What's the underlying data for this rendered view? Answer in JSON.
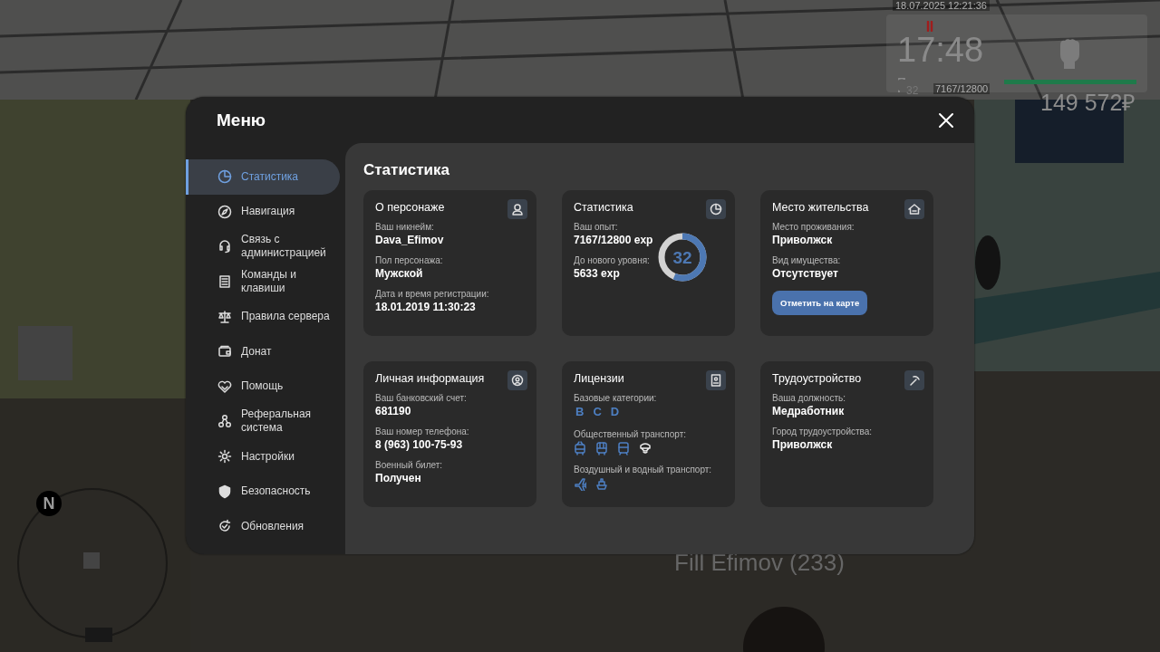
{
  "hud": {
    "datetime": "18.07.2025 12:21:36",
    "clock": "17:48",
    "level": "32",
    "experience": "7167/12800",
    "money": "149 572₽",
    "player_tag": "Fill Efimov (233)",
    "compass": "N"
  },
  "menu": {
    "title": "Меню",
    "sidebar": {
      "items": [
        {
          "label": "Статистика",
          "selected": true
        },
        {
          "label": "Навигация",
          "selected": false
        },
        {
          "label": "Связь с администрацией",
          "selected": false
        },
        {
          "label": "Команды и клавиши",
          "selected": false
        },
        {
          "label": "Правила сервера",
          "selected": false
        },
        {
          "label": "Донат",
          "selected": false
        },
        {
          "label": "Помощь",
          "selected": false
        },
        {
          "label": "Реферальная система",
          "selected": false
        },
        {
          "label": "Настройки",
          "selected": false
        },
        {
          "label": "Безопасность",
          "selected": false
        },
        {
          "label": "Обновления",
          "selected": false
        }
      ]
    },
    "content": {
      "heading": "Статистика",
      "cards": [
        {
          "kind": "character",
          "title": "О персонаже",
          "fields": [
            {
              "label": "Ваш никнейм:",
              "value": "Dava_Efimov"
            },
            {
              "label": "Пол персонажа:",
              "value": "Мужской"
            },
            {
              "label": "Дата и время регистрации:",
              "value": "18.01.2019 11:30:23"
            }
          ]
        },
        {
          "kind": "stats",
          "title": "Статистика",
          "fields": [
            {
              "label": "Ваш опыт:",
              "value": "7167/12800 exp"
            },
            {
              "label": "До нового уровня:",
              "value": "5633 exp"
            }
          ],
          "ring": {
            "value": "32",
            "level": 0.56
          }
        },
        {
          "kind": "residence",
          "title": "Место жительства",
          "fields": [
            {
              "label": "Место проживания:",
              "value": "Приволжск"
            },
            {
              "label": "Вид имущества:",
              "value": "Отсутствует"
            }
          ],
          "button": "Отметить на карте"
        },
        {
          "kind": "personal",
          "title": "Личная информация",
          "fields": [
            {
              "label": "Ваш банковский счет:",
              "value": "681190"
            },
            {
              "label": "Ваш номер телефона:",
              "value": "8 (963) 100-75-93"
            },
            {
              "label": "Военный билет:",
              "value": "Получен"
            }
          ]
        },
        {
          "kind": "licenses",
          "title": "Лицензии",
          "sections": [
            {
              "kind": "letters",
              "label": "Базовые категории:",
              "letters": [
                "B",
                "C",
                "D"
              ]
            },
            {
              "kind": "public-transport",
              "label": "Общественный транспорт:"
            },
            {
              "kind": "air-water",
              "label": "Воздушный и водный транспорт:"
            }
          ]
        },
        {
          "kind": "job",
          "title": "Трудоустройство",
          "fields": [
            {
              "label": "Ваша должность:",
              "value": "Медработник"
            },
            {
              "label": "Город трудоустройства:",
              "value": "Приволжск"
            }
          ]
        }
      ]
    }
  }
}
